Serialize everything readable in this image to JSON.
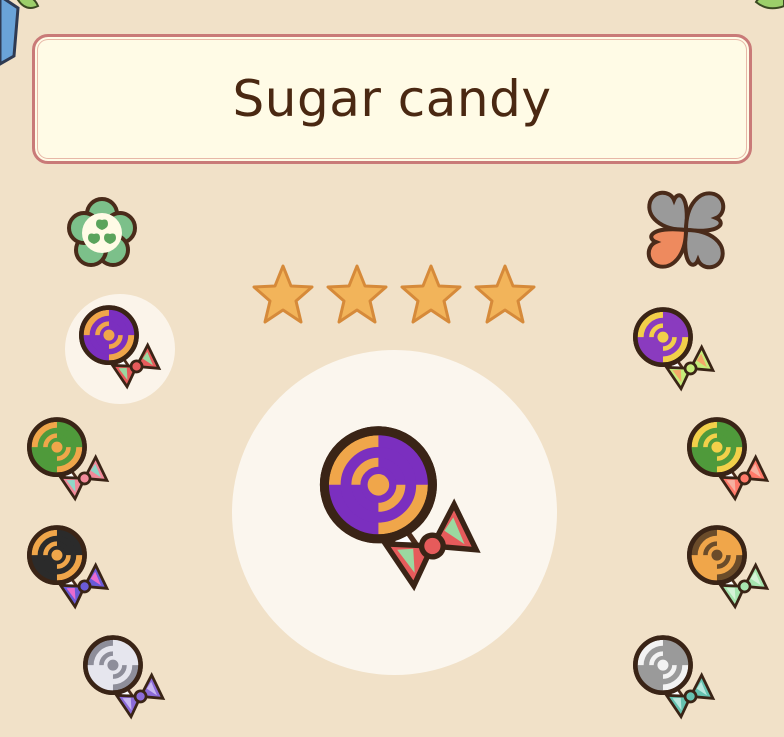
{
  "item": {
    "name": "Sugar candy",
    "rating": 4
  },
  "icons": {
    "top_left": "clover-badge-icon",
    "top_right": "four-leaf-clover-icon",
    "star": "star-icon"
  },
  "candies": [
    {
      "side": "left",
      "name": "lollipop-purple-orange-icon",
      "swirl": [
        "#7b2fbf",
        "#f0a64a"
      ],
      "bow": [
        "#e65b5b",
        "#9bd8a0"
      ]
    },
    {
      "side": "left",
      "name": "lollipop-green-orange-icon",
      "swirl": [
        "#4f9a3b",
        "#f0a64a"
      ],
      "bow": [
        "#f18a9a",
        "#8fd7c8"
      ]
    },
    {
      "side": "left",
      "name": "lollipop-black-orange-icon",
      "swirl": [
        "#2b2b2b",
        "#f0a64a"
      ],
      "bow": [
        "#6a5bd8",
        "#e86bd0"
      ]
    },
    {
      "side": "left",
      "name": "lollipop-white-gray-icon",
      "swirl": [
        "#e6e6ee",
        "#8e8e9a"
      ],
      "bow": [
        "#8b6bd8",
        "#c6b6f0"
      ]
    },
    {
      "side": "right",
      "name": "lollipop-purple-yellow-icon",
      "swirl": [
        "#8a3bbf",
        "#f2d04a"
      ],
      "bow": [
        "#c6ec7a",
        "#f4a96a"
      ]
    },
    {
      "side": "right",
      "name": "lollipop-green-yellow-icon",
      "swirl": [
        "#4f9a3b",
        "#f2d04a"
      ],
      "bow": [
        "#ff7a6a",
        "#f6b1a0"
      ]
    },
    {
      "side": "right",
      "name": "lollipop-orange-brown-icon",
      "swirl": [
        "#f0a64a",
        "#6b4c2a"
      ],
      "bow": [
        "#a7e6b0",
        "#d5f3d8"
      ]
    },
    {
      "side": "right",
      "name": "lollipop-gray-white-icon",
      "swirl": [
        "#9a9a9a",
        "#f3f3f3"
      ],
      "bow": [
        "#66c2b0",
        "#b8e7dd"
      ]
    }
  ],
  "preview": {
    "name": "lollipop-preview-icon",
    "swirl": [
      "#7b2fbf",
      "#f0a64a"
    ],
    "bow": [
      "#e65b5b",
      "#9bd8a0"
    ]
  },
  "colors": {
    "background": "#f1e1c8",
    "title_text": "#4a2812",
    "outline": "#4a2b1a",
    "star_fill": "#f2b45a"
  }
}
